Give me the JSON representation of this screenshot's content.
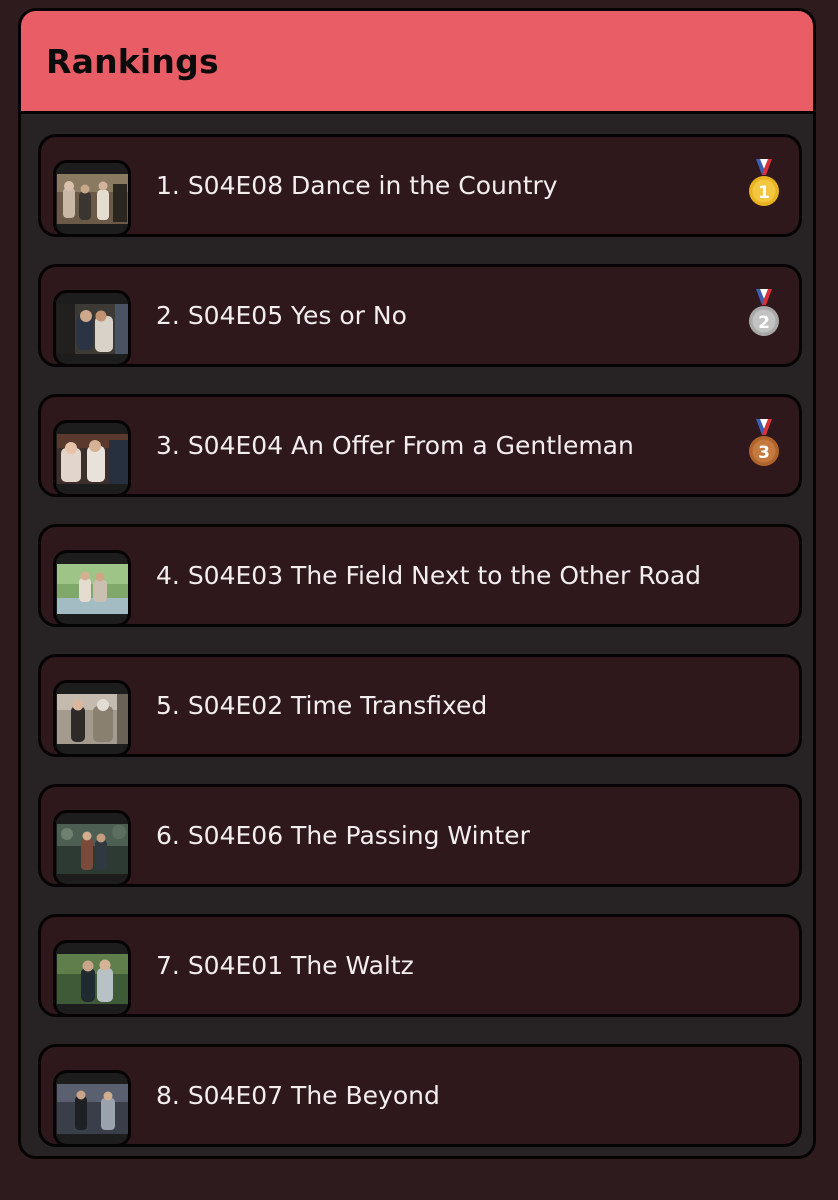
{
  "panel": {
    "title": "Rankings"
  },
  "rankings": [
    {
      "rank_label": "1.",
      "title": "S04E08 Dance in the Country",
      "medal": "gold-medal-icon",
      "medal_number": "1"
    },
    {
      "rank_label": "2.",
      "title": "S04E05 Yes or No",
      "medal": "silver-medal-icon",
      "medal_number": "2"
    },
    {
      "rank_label": "3.",
      "title": "S04E04 An Offer From a Gentleman",
      "medal": "bronze-medal-icon",
      "medal_number": "3"
    },
    {
      "rank_label": "4.",
      "title": "S04E03 The Field Next to the Other Road"
    },
    {
      "rank_label": "5.",
      "title": "S04E02 Time Transfixed"
    },
    {
      "rank_label": "6.",
      "title": "S04E06 The Passing Winter"
    },
    {
      "rank_label": "7.",
      "title": "S04E01 The Waltz"
    },
    {
      "rank_label": "8.",
      "title": "S04E07 The Beyond"
    }
  ],
  "colors": {
    "header": "#e85d66",
    "panel": "#272223",
    "row": "#2e181c",
    "text": "#f3eeee",
    "gold": "#e8b321",
    "silver": "#a9a9a9",
    "bronze": "#b0642c"
  }
}
